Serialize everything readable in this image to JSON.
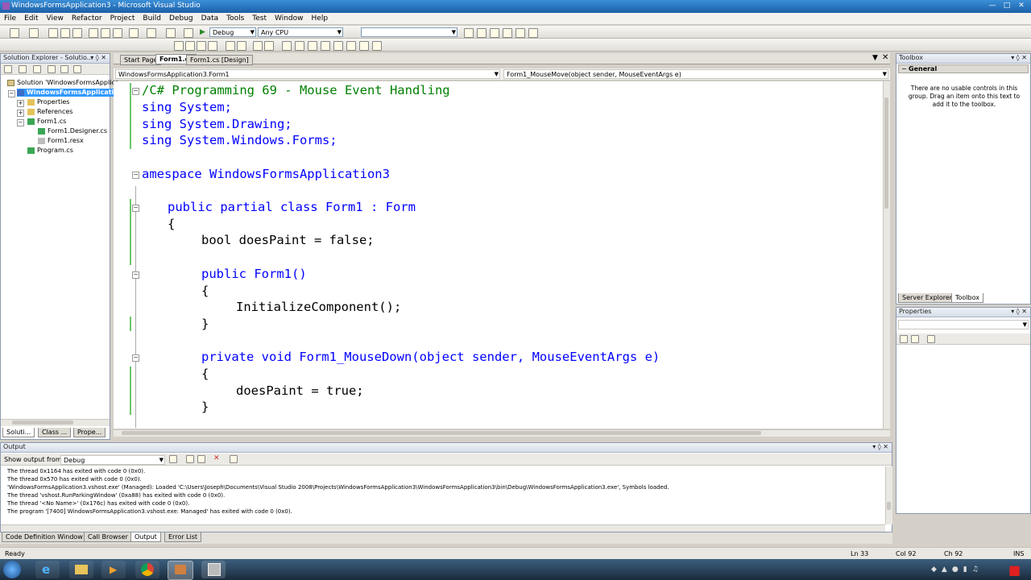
{
  "window": {
    "title": "WindowsFormsApplication3 - Microsoft Visual Studio",
    "controls": [
      "minimize-icon",
      "maximize-icon",
      "close-icon"
    ]
  },
  "menu": [
    "File",
    "Edit",
    "View",
    "Refactor",
    "Project",
    "Build",
    "Debug",
    "Data",
    "Tools",
    "Test",
    "Window",
    "Help"
  ],
  "toolbar": {
    "config": "Debug",
    "platform": "Any CPU"
  },
  "solution_explorer": {
    "title": "Solution Explorer - Solutio...",
    "items": [
      {
        "label": "Solution 'WindowsFormsApplica",
        "icon": "solution-icon"
      },
      {
        "label": "WindowsFormsApplication3",
        "icon": "project-icon"
      },
      {
        "label": "Properties",
        "icon": "folder-icon"
      },
      {
        "label": "References",
        "icon": "folder-icon"
      },
      {
        "label": "Form1.cs",
        "icon": "form-icon"
      },
      {
        "label": "Form1.Designer.cs",
        "icon": "cs-file-icon"
      },
      {
        "label": "Form1.resx",
        "icon": "resx-icon"
      },
      {
        "label": "Program.cs",
        "icon": "cs-file-icon"
      }
    ],
    "tabs": [
      "Soluti...",
      "Class ...",
      "Prope..."
    ]
  },
  "editor": {
    "tabs": [
      "Start Page",
      "Form1.cs",
      "Form1.cs [Design]"
    ],
    "class_dropdown": "WindowsFormsApplication3.Form1",
    "member_dropdown": "Form1_MouseMove(object sender, MouseEventArgs e)",
    "lines": [
      "/C# Programming 69 - Mouse Event Handling",
      "sing System;",
      "sing System.Drawing;",
      "sing System.Windows.Forms;",
      "amespace WindowsFormsApplication3",
      "public partial class Form1 : Form",
      "{",
      "bool doesPaint = false;",
      "public Form1()",
      "{",
      "InitializeComponent();",
      "}",
      "private void Form1_MouseDown(object sender, MouseEventArgs e)",
      "{",
      "doesPaint = true;",
      "}"
    ]
  },
  "toolbox": {
    "title": "Toolbox",
    "group": "General",
    "empty_message": "There are no usable controls in this group. Drag an item onto this text to add it to the toolbox.",
    "tabs": [
      "Server Explorer",
      "Toolbox"
    ]
  },
  "properties": {
    "title": "Properties"
  },
  "output": {
    "title": "Output",
    "show_output_label": "Show output from:",
    "show_output_value": "Debug",
    "lines": [
      "The thread 0x1164 has exited with code 0 (0x0).",
      "The thread 0x570 has exited with code 0 (0x0).",
      "'WindowsFormsApplication3.vshost.exe' (Managed): Loaded 'C:\\Users\\Joseph\\Documents\\Visual Studio 2008\\Projects\\WindowsFormsApplication3\\WindowsFormsApplication3\\bin\\Debug\\WindowsFormsApplication3.exe', Symbols loaded.",
      "The thread 'vshost.RunParkingWindow' (0xa88) has exited with code 0 (0x0).",
      "The thread '<No Name>' (0x176c) has exited with code 0 (0x0).",
      "The program '[7400] WindowsFormsApplication3.vshost.exe: Managed' has exited with code 0 (0x0)."
    ]
  },
  "bottom_tabs": [
    "Code Definition Window",
    "Call Browser",
    "Output",
    "Error List"
  ],
  "status": {
    "state": "Ready",
    "ln": "Ln 33",
    "col": "Col 92",
    "ch": "Ch 92",
    "mode": "INS"
  },
  "colors": {
    "keyword": "#0000ff",
    "type": "#2b91af",
    "comment": "#008000",
    "change_bar": "#6dc66b"
  }
}
